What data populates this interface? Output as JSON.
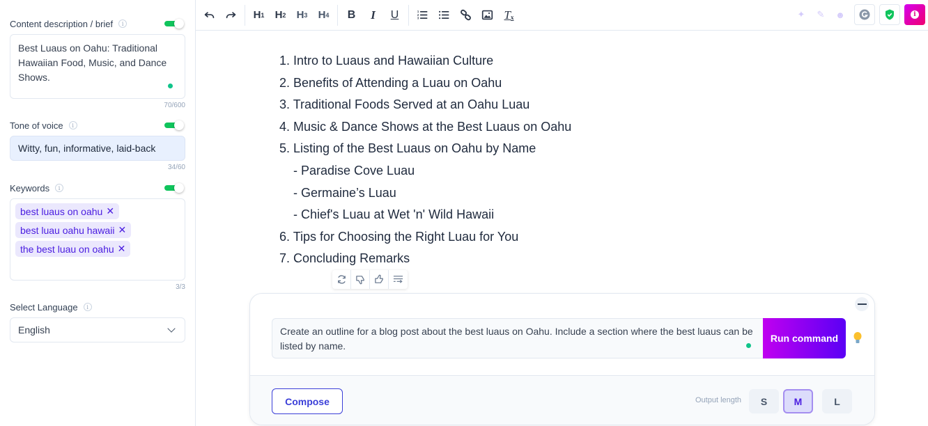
{
  "sidebar": {
    "content_brief": {
      "label": "Content description / brief",
      "value": "Best Luaus on Oahu: Traditional Hawaiian Food, Music, and Dance Shows.",
      "counter": "70/600",
      "enabled": true
    },
    "tone": {
      "label": "Tone of voice",
      "value": "Witty, fun, informative, laid-back",
      "counter": "34/60",
      "enabled": true
    },
    "keywords": {
      "label": "Keywords",
      "items": [
        "best luaus on oahu",
        "best luau oahu hawaii",
        "the best luau on oahu"
      ],
      "counter": "3/3",
      "enabled": true
    },
    "language": {
      "label": "Select Language",
      "selected": "English"
    }
  },
  "toolbar": {
    "undo": "undo-icon",
    "redo": "redo-icon",
    "headings": [
      {
        "main": "H",
        "sub": "1"
      },
      {
        "main": "H",
        "sub": "2"
      },
      {
        "main": "H",
        "sub": "3"
      },
      {
        "main": "H",
        "sub": "4"
      }
    ],
    "bold": "B",
    "italic": "I",
    "underline": "U",
    "clear_format": "T",
    "clear_format_sub": "x",
    "info": "i"
  },
  "editor": {
    "lines": [
      {
        "text": "1. Intro to Luaus and Hawaiian Culture",
        "sub": false
      },
      {
        "text": "2. Benefits of Attending a Luau on Oahu",
        "sub": false
      },
      {
        "text": "3. Traditional Foods Served at an Oahu Luau",
        "sub": false
      },
      {
        "text": "4. Music & Dance Shows at the Best Luaus on Oahu",
        "sub": false
      },
      {
        "text": "5. Listing of the Best Luaus on Oahu by Name",
        "sub": false
      },
      {
        "text": "- Paradise Cove Luau",
        "sub": true
      },
      {
        "text": "- Germaine’s Luau",
        "sub": true
      },
      {
        "text": "- Chief's Luau at Wet 'n' Wild Hawaii",
        "sub": true
      },
      {
        "text": "6. Tips for Choosing the Right Luau for You",
        "sub": false
      },
      {
        "text": "7. Concluding Remarks",
        "sub": false
      }
    ]
  },
  "command": {
    "prompt": "Create an outline for a blog post about the best luaus on Oahu. Include a section where the best luaus can be listed by name.",
    "run_label": "Run command",
    "compose_label": "Compose",
    "output_length_label": "Output length",
    "sizes": [
      "S",
      "M",
      "L"
    ],
    "selected_size": "M"
  },
  "colors": {
    "accent": "#4b1ee0",
    "toggle_on": "#10c45c",
    "run_gradient_start": "#c000f0",
    "run_gradient_end": "#5a00f5"
  }
}
